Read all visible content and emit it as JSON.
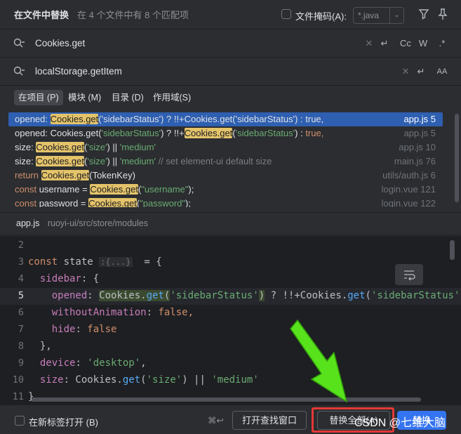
{
  "header": {
    "title": "在文件中替换",
    "summary": "在 4 个文件中有 8 个匹配项",
    "file_mask_label": "文件掩码(A):",
    "file_mask_value": "*.java",
    "file_mask_checked": false
  },
  "search": {
    "find_value": "Cookies.get",
    "replace_value": "localStorage.getItem",
    "find_options": [
      "Cc",
      "W",
      ".*"
    ],
    "replace_options": [
      "AA"
    ]
  },
  "scope_tabs": [
    {
      "label": "在项目 (P)",
      "active": true
    },
    {
      "label": "模块 (M)",
      "active": false
    },
    {
      "label": "目录 (D)",
      "active": false
    },
    {
      "label": "作用域(S)",
      "active": false
    }
  ],
  "results": [
    {
      "segments": [
        [
          "opened: ",
          ""
        ],
        [
          "Cookies.get",
          "hl"
        ],
        [
          "('sidebarStatus') ? !!+Cookies.get('sidebarStatus') : true,",
          ""
        ]
      ],
      "file": "app.js 5",
      "selected": true
    },
    {
      "segments": [
        [
          "opened: Cookies.get(",
          "dim"
        ],
        [
          "'sidebarStatus'",
          "s-str"
        ],
        [
          ") ? !!+",
          "dim"
        ],
        [
          "Cookies.get",
          "hl"
        ],
        [
          "(",
          "dim"
        ],
        [
          "'sidebarStatus'",
          "s-str"
        ],
        [
          ") : ",
          "dim"
        ],
        [
          "true,",
          "s-kw"
        ]
      ],
      "file": "app.js 5",
      "selected": false
    },
    {
      "segments": [
        [
          "size: ",
          ""
        ],
        [
          "Cookies.get",
          "hl"
        ],
        [
          "(",
          ""
        ],
        [
          "'size'",
          "s-str"
        ],
        [
          ") || ",
          ""
        ],
        [
          "'medium'",
          "s-str"
        ]
      ],
      "file": "app.js 10",
      "selected": false
    },
    {
      "segments": [
        [
          "size: ",
          ""
        ],
        [
          "Cookies.get",
          "hl"
        ],
        [
          "(",
          ""
        ],
        [
          "'size'",
          "s-str"
        ],
        [
          ") || ",
          ""
        ],
        [
          "'medium'",
          "s-str"
        ],
        [
          " // set element-ui default size",
          "s-cm"
        ]
      ],
      "file": "main.js 76",
      "selected": false
    },
    {
      "segments": [
        [
          "return ",
          "s-kw"
        ],
        [
          "Cookies.get",
          "hl"
        ],
        [
          "(TokenKey)",
          ""
        ]
      ],
      "file": "utils/auth.js 6",
      "selected": false
    },
    {
      "segments": [
        [
          "const ",
          "s-kw"
        ],
        [
          "username = ",
          ""
        ],
        [
          "Cookies.get",
          "hl"
        ],
        [
          "(",
          ""
        ],
        [
          "\"username\"",
          "s-str"
        ],
        [
          ");",
          ""
        ]
      ],
      "file": "login.vue 121",
      "selected": false
    },
    {
      "segments": [
        [
          "const ",
          "s-kw"
        ],
        [
          "password = ",
          ""
        ],
        [
          "Cookies.get",
          "hl"
        ],
        [
          "(",
          ""
        ],
        [
          "\"password\"",
          "s-str"
        ],
        [
          ");",
          ""
        ]
      ],
      "file": "login.vue 122",
      "selected": false
    }
  ],
  "preview": {
    "file": "app.js",
    "dir": "ruoyi-ui/src/store/modules",
    "lines": [
      {
        "n": "2",
        "code": []
      },
      {
        "n": "3",
        "code": [
          [
            "const ",
            "c-kw"
          ],
          [
            "state ",
            ""
          ],
          [
            ":{...}",
            "c-fold"
          ],
          [
            "  = {",
            ""
          ]
        ]
      },
      {
        "n": "4",
        "code": [
          [
            "  ",
            ""
          ],
          [
            "sidebar",
            "c-prop"
          ],
          [
            ": {",
            ""
          ]
        ]
      },
      {
        "n": "5",
        "code": [
          [
            "    ",
            ""
          ],
          [
            "opened",
            "c-prop"
          ],
          [
            ": ",
            ""
          ],
          [
            "Cookies.",
            "hlc"
          ],
          [
            "get",
            "hlcfn"
          ],
          [
            "(",
            "hlc"
          ],
          [
            "'sidebarStatus'",
            "c-str"
          ],
          [
            ")",
            "hlc"
          ],
          [
            " ? !!+Cookies.",
            ""
          ],
          [
            "get",
            "c-fn"
          ],
          [
            "(",
            ""
          ],
          [
            "'sidebarStatus'",
            "c-str"
          ],
          [
            ")",
            ""
          ]
        ],
        "current": true
      },
      {
        "n": "6",
        "code": [
          [
            "    ",
            ""
          ],
          [
            "withoutAnimation",
            "c-prop"
          ],
          [
            ": ",
            ""
          ],
          [
            "false,",
            "c-kw"
          ]
        ]
      },
      {
        "n": "7",
        "code": [
          [
            "    ",
            ""
          ],
          [
            "hide",
            "c-prop"
          ],
          [
            ": ",
            ""
          ],
          [
            "false",
            "c-kw"
          ]
        ]
      },
      {
        "n": "8",
        "code": [
          [
            "  },",
            ""
          ]
        ]
      },
      {
        "n": "9",
        "code": [
          [
            "  ",
            ""
          ],
          [
            "device",
            "c-prop"
          ],
          [
            ": ",
            ""
          ],
          [
            "'desktop'",
            "c-str"
          ],
          [
            ",",
            ""
          ]
        ]
      },
      {
        "n": "10",
        "code": [
          [
            "  ",
            ""
          ],
          [
            "size",
            "c-prop"
          ],
          [
            ": Cookies.",
            ""
          ],
          [
            "get",
            "c-fn"
          ],
          [
            "(",
            ""
          ],
          [
            "'size'",
            "c-str"
          ],
          [
            ") || ",
            ""
          ],
          [
            "'medium'",
            "c-str"
          ]
        ]
      },
      {
        "n": "11",
        "code": [
          [
            "}",
            ""
          ]
        ]
      }
    ]
  },
  "footer": {
    "open_new_tab_label": "在新标签打开 (B)",
    "shortcut": "⌘↩",
    "open_find_window": "打开查找窗口",
    "replace_all": "替换全部(A)",
    "replace_button": "替换"
  },
  "watermark": "CSDN @七维大脑",
  "colors": {
    "accent": "#3574f0",
    "selected_row": "#2e5fb1",
    "match_highlight": "#e4c36a",
    "annotation_red": "#e53935",
    "annotation_arrow": "#58e21c"
  }
}
